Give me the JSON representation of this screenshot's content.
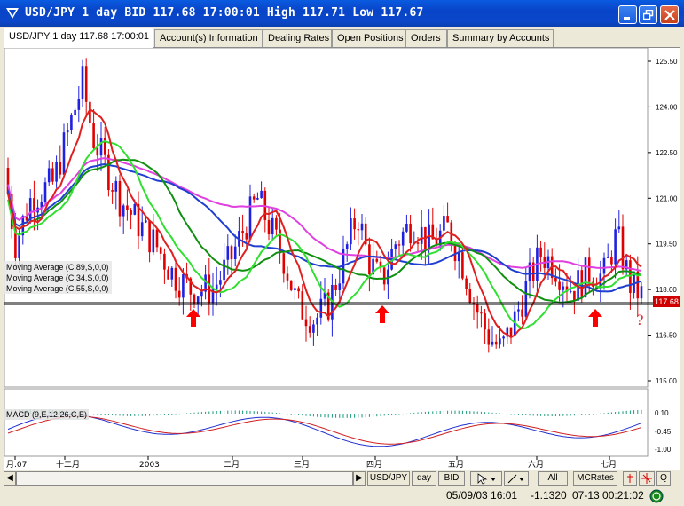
{
  "window": {
    "title": "USD/JPY 1 day BID 117.68 17:00:01 High 117.71 Low 117.67"
  },
  "tabs": [
    {
      "label": "USD/JPY 1 day 117.68 17:00:01",
      "active": true
    },
    {
      "label": "Account(s) Information",
      "active": false
    },
    {
      "label": "Dealing Rates",
      "active": false
    },
    {
      "label": "Open Positions",
      "active": false
    },
    {
      "label": "Orders",
      "active": false
    },
    {
      "label": "Summary by Accounts",
      "active": false
    }
  ],
  "chart": {
    "price_axis_labels": [
      "125.50",
      "124.00",
      "122.50",
      "121.00",
      "119.50",
      "118.00",
      "116.50",
      "115.00"
    ],
    "current_price_label": "117.68",
    "indicator_legend": [
      "Moving Average (C,89,S,0,0)",
      "Moving Average (C,34,S,0,0)",
      "Moving Average (C,55,S,0,0)"
    ],
    "question_mark": "?",
    "macd_label": "MACD (9,E,12,26,C,E)",
    "macd_axis_labels": [
      "0.10",
      "-0.45",
      "-1.00"
    ],
    "date_axis_labels": [
      "月.07",
      "十二月",
      "2003",
      "二月",
      "三月",
      "四月",
      "五月",
      "六月",
      "七月"
    ],
    "colors": {
      "ma89": "#e040e0",
      "ma34": "#e02020",
      "ma55": "#109010",
      "ma_blue": "#1f3fd0",
      "ma_green": "#30e030",
      "candle_up": "#2020e0",
      "candle_down": "#e00000",
      "arrow": "#ff0000",
      "support_line": "#000000",
      "price_tag": "#d00000"
    }
  },
  "chart_data": {
    "type": "candlestick",
    "symbol": "USD/JPY",
    "timeframe": "1 day",
    "y_range": [
      115.0,
      125.5
    ],
    "support_level": 117.68,
    "close_levels_sample": [
      122.0,
      119.5,
      121.5,
      124.8,
      123.0,
      121.0,
      119.0,
      118.0,
      117.9,
      120.5,
      118.8,
      116.8,
      118.0,
      119.5,
      118.0,
      120.5,
      119.8,
      117.5,
      116.0,
      117.0,
      119.5,
      118.0,
      117.8,
      119.8,
      117.68
    ]
  },
  "toolbar": {
    "symbol_button": "USD/JPY",
    "period_button": "day",
    "side_button": "BID",
    "range_button": "All",
    "rates_button": "MCRates",
    "q_button": "Q"
  },
  "status": {
    "date_time": "05/09/03 16:01",
    "value": "-1.1320",
    "clock": "07-13 00:21:02"
  }
}
